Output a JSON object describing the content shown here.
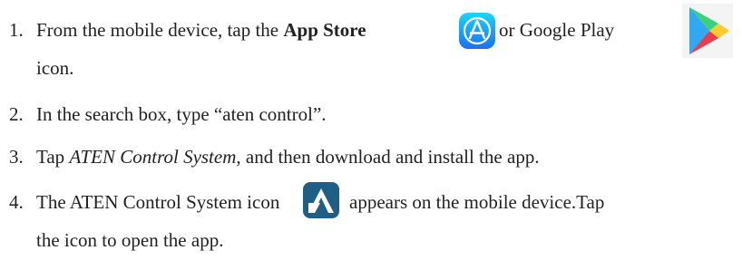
{
  "steps": [
    {
      "number": "1.",
      "text_a": "From the mobile device, tap the ",
      "bold": "App Store",
      "text_b": " or Google Play",
      "continuation": "icon.",
      "icons": [
        "app-store-icon",
        "google-play-icon"
      ]
    },
    {
      "number": "2.",
      "text": "In the search box, type “aten control”."
    },
    {
      "number": "3.",
      "text_a": "Tap ",
      "italic": "ATEN Control System",
      "text_b": ", and then download and install the app."
    },
    {
      "number": "4.",
      "text_a": "The ATEN Control System icon",
      "text_b": "appears on the mobile device.Tap",
      "continuation": "the icon to open the app.",
      "icons": [
        "aten-control-system-icon"
      ]
    }
  ],
  "colors": {
    "app_store_blue": "#1E8EF2",
    "aten_blue": "#1F5F86",
    "text": "#222222"
  }
}
